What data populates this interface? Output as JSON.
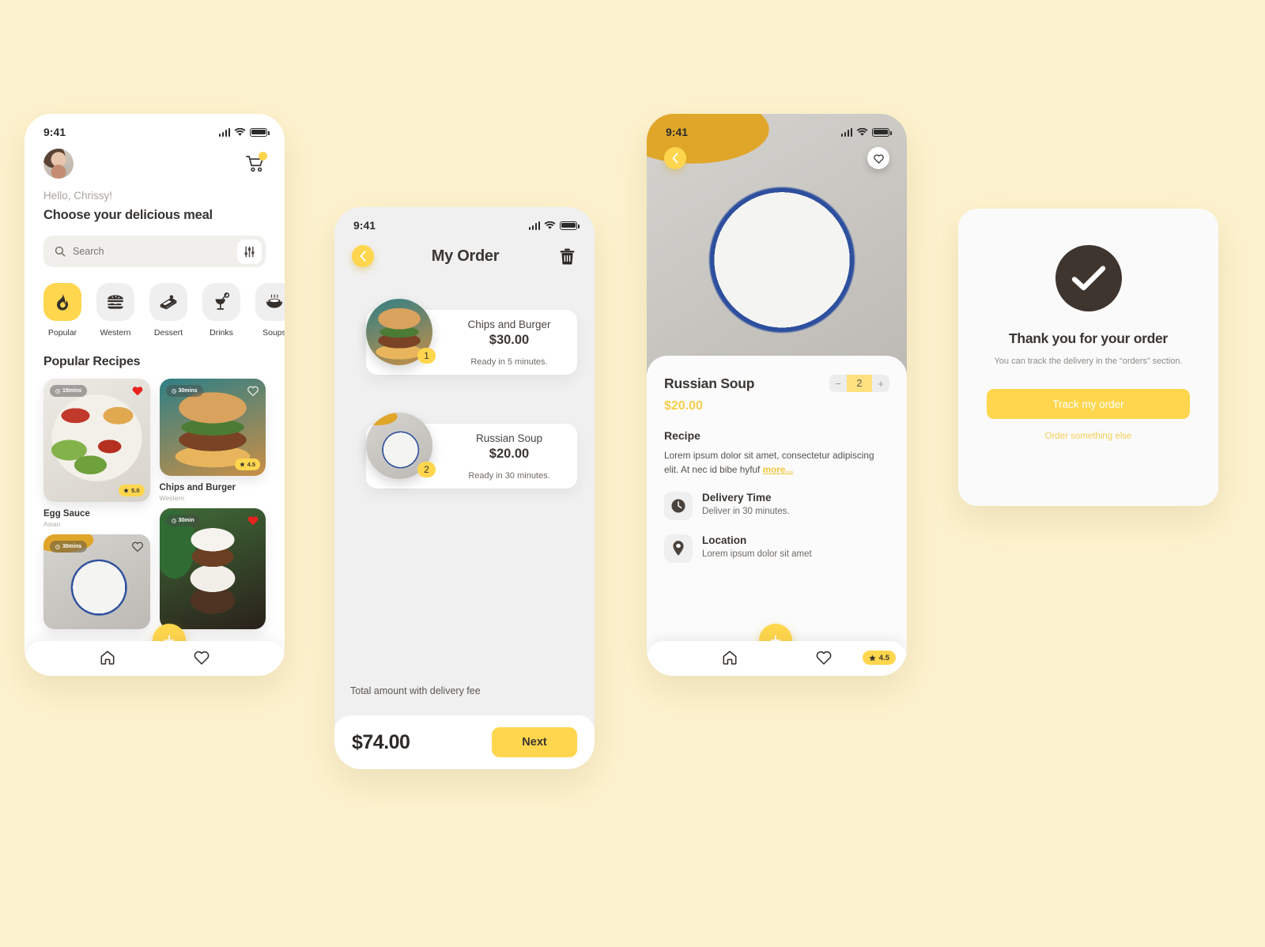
{
  "theme": {
    "background": "#FDF2CE",
    "accent": "#FFD64D",
    "dark": "#3F352F",
    "surface": "#FFFFFF"
  },
  "screen_home": {
    "status": {
      "time": "9:41",
      "signal_icon": "signal-icon",
      "wifi_icon": "wifi-icon",
      "battery_icon": "battery-icon"
    },
    "avatar_name": "avatar",
    "cart_icon": "cart-icon",
    "greeting": "Hello, Chrissy!",
    "headline": "Choose your delicious meal",
    "search": {
      "placeholder": "Search",
      "value": "",
      "icon": "search-icon",
      "filter_icon": "filter-icon"
    },
    "categories": [
      {
        "label": "Popular",
        "icon": "flame-icon",
        "active": true
      },
      {
        "label": "Western",
        "icon": "burger-icon",
        "active": false
      },
      {
        "label": "Dessert",
        "icon": "cake-icon",
        "active": false
      },
      {
        "label": "Drinks",
        "icon": "cocktail-icon",
        "active": false
      },
      {
        "label": "Soups",
        "icon": "soup-bowl-icon",
        "active": false
      }
    ],
    "section_title": "Popular Recipes",
    "recipes": [
      {
        "name": "Egg Sauce",
        "category": "Asian",
        "time": "15mins",
        "rating": "5.0",
        "favorite": true,
        "photo": "salad"
      },
      {
        "name": "Chips and Burger",
        "category": "Western",
        "time": "30mins",
        "rating": "4.5",
        "favorite": false,
        "photo": "burger"
      },
      {
        "name": "",
        "category": "",
        "time": "30mins",
        "rating": "",
        "favorite": false,
        "photo": "soup"
      },
      {
        "name": "",
        "category": "",
        "time": "30min",
        "rating": "",
        "favorite": true,
        "photo": "dessert"
      }
    ],
    "fab_label": "+",
    "nav": [
      {
        "icon": "home-icon"
      },
      {
        "icon": "heart-icon"
      }
    ]
  },
  "screen_order": {
    "status": {
      "time": "9:41"
    },
    "back_icon": "chevron-left-icon",
    "title": "My Order",
    "delete_icon": "trash-icon",
    "items": [
      {
        "name": "Chips and Burger",
        "price": "$30.00",
        "ready": "Ready in 5 minutes.",
        "qty": "1",
        "photo": "burger"
      },
      {
        "name": "Russian Soup",
        "price": "$20.00",
        "ready": "Ready in 30 minutes.",
        "qty": "2",
        "photo": "soup"
      }
    ],
    "total_label": "Total amount with delivery fee",
    "total_amount": "$74.00",
    "next_label": "Next"
  },
  "screen_detail": {
    "status": {
      "time": "9:41"
    },
    "back_icon": "chevron-left-icon",
    "favorite_icon": "heart-icon",
    "hero_rating": "4.5",
    "name": "Russian Soup",
    "price": "$20.00",
    "quantity": "2",
    "decrement_label": "−",
    "increment_label": "+",
    "recipe_heading": "Recipe",
    "recipe_text": "Lorem ipsum dolor sit amet, consectetur adipiscing elit. At nec id bibe hyfuf ",
    "recipe_more": "more...",
    "info": [
      {
        "icon": "clock-icon",
        "title": "Delivery Time",
        "subtitle": "Deliver in 30 minutes."
      },
      {
        "icon": "location-pin-icon",
        "title": "Location",
        "subtitle": "Lorem ipsum dolor sit amet"
      }
    ],
    "fab_label": "+",
    "nav": [
      {
        "icon": "home-icon"
      },
      {
        "icon": "heart-icon"
      }
    ]
  },
  "screen_thanks": {
    "check_icon": "check-circle-icon",
    "title": "Thank you for your order",
    "subtitle": "You can track the delivery in the “orders” section.",
    "primary_label": "Track my order",
    "secondary_label": "Order something else"
  }
}
